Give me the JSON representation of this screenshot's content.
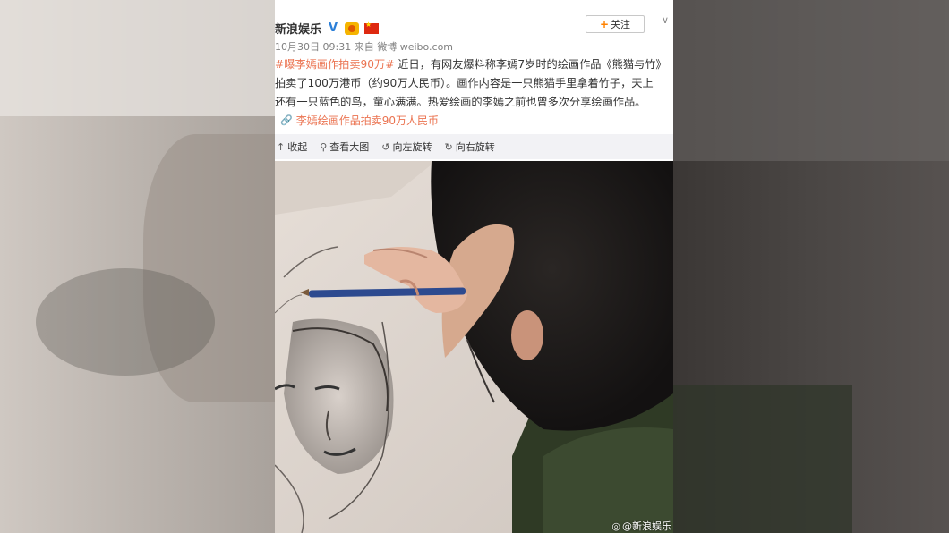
{
  "post": {
    "account_name": "新浪娱乐",
    "verified_icon": "verified-v-icon",
    "follow_label": "关注",
    "timestamp": "10月30日 09:31",
    "source": "来自 微博 weibo.com",
    "hashtag": "#曝李嫣画作拍卖90万#",
    "line1_rest": " 近日，有网友爆料称李嫣7岁时的绘画作品《熊猫与竹》",
    "line2": "拍卖了100万港币（约90万人民币）。画作内容是一只熊猫手里拿着竹子，天上",
    "line3": "还有一只蓝色的鸟，童心满满。热爱绘画的李嫣之前也曾多次分享绘画作品。",
    "link_text": "李嫣绘画作品拍卖90万人民币"
  },
  "toolbar": {
    "collapse_label": "收起",
    "view_large_label": "查看大图",
    "rotate_left_label": "向左旋转",
    "rotate_right_label": "向右旋转"
  },
  "photo": {
    "watermark": "@新浪娱乐"
  },
  "colors": {
    "link": "#eb7350",
    "follow_plus": "#ff8200",
    "toolbar_bg": "#f2f2f5"
  }
}
